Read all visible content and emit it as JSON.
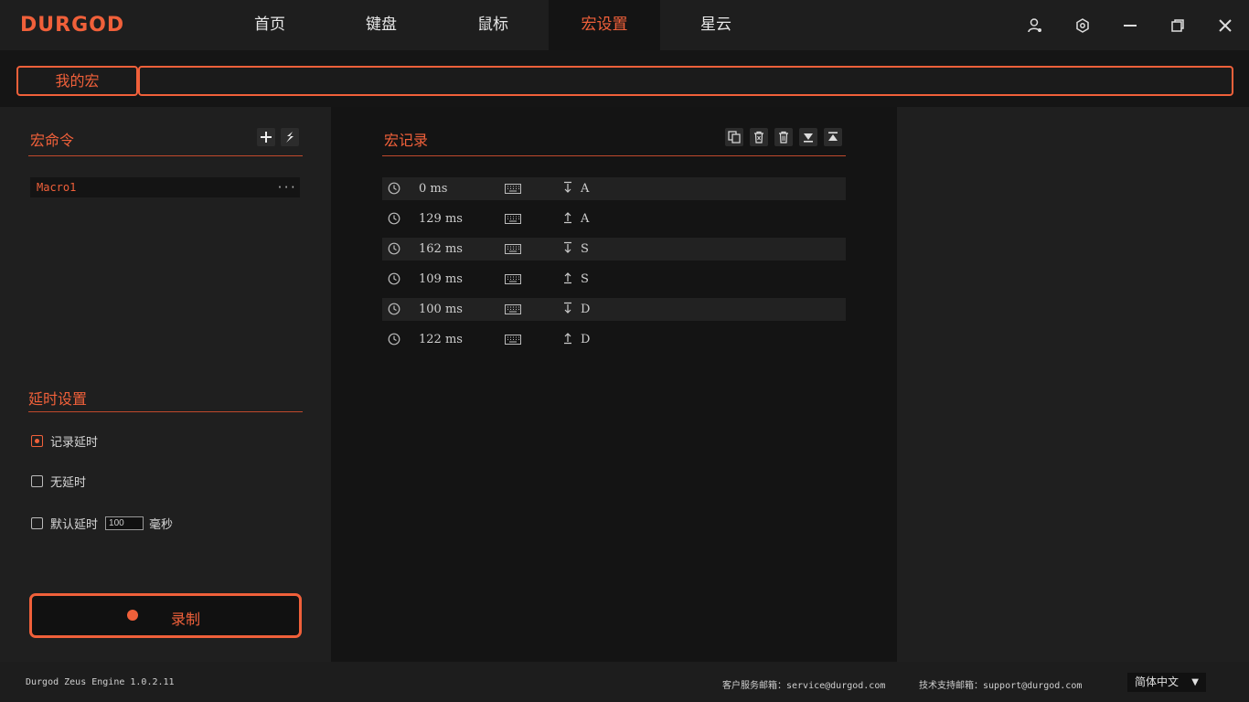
{
  "app": {
    "logo": "DURGOD"
  },
  "nav": {
    "items": [
      {
        "label": "首页"
      },
      {
        "label": "键盘"
      },
      {
        "label": "鼠标"
      },
      {
        "label": "宏设置"
      },
      {
        "label": "星云"
      }
    ],
    "active_index": 3
  },
  "window_controls": [
    "user-icon",
    "settings-hex-icon",
    "minimize-icon",
    "restore-icon",
    "close-icon"
  ],
  "tabs": {
    "my_macro": "我的宏"
  },
  "macro_commands": {
    "title": "宏命令",
    "items": [
      {
        "name": "Macro1",
        "more": "···"
      }
    ]
  },
  "delay_settings": {
    "title": "延时设置",
    "options": [
      {
        "label": "记录延时",
        "checked": true
      },
      {
        "label": "无延时",
        "checked": false
      },
      {
        "label": "默认延时",
        "checked": false,
        "value": "100",
        "unit": "毫秒"
      }
    ]
  },
  "record_button": {
    "label": "录制"
  },
  "macro_record": {
    "title": "宏记录",
    "rows": [
      {
        "delay": "0 ms",
        "direction": "down",
        "key": "A"
      },
      {
        "delay": "129 ms",
        "direction": "up",
        "key": "A"
      },
      {
        "delay": "162 ms",
        "direction": "down",
        "key": "S"
      },
      {
        "delay": "109 ms",
        "direction": "up",
        "key": "S"
      },
      {
        "delay": "100 ms",
        "direction": "down",
        "key": "D"
      },
      {
        "delay": "122 ms",
        "direction": "up",
        "key": "D"
      }
    ]
  },
  "footer": {
    "version": "Durgod Zeus Engine 1.0.2.11",
    "service_email": "客户服务邮箱：service@durgod.com",
    "support_email": "技术支持邮箱：support@durgod.com",
    "language": "简体中文"
  },
  "colors": {
    "accent": "#f0603a",
    "bg": "#1b1b1b",
    "panel": "#1f1f1f",
    "dark": "#141414"
  }
}
